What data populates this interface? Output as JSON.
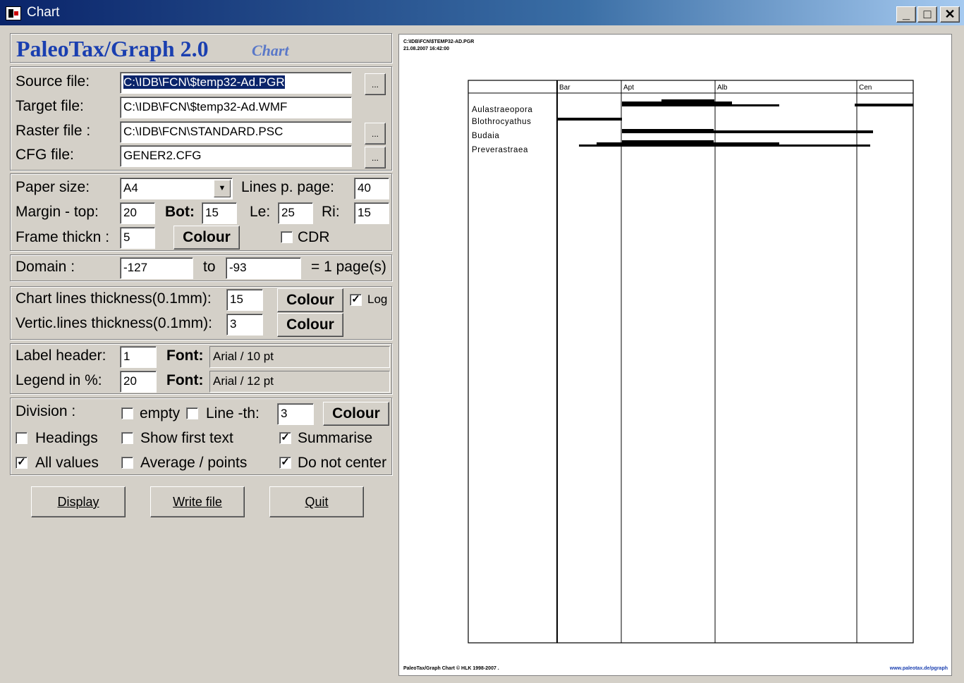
{
  "window": {
    "title": "Chart"
  },
  "app": {
    "name": "PaleoTax/Graph 2.0",
    "subtitle": "Chart"
  },
  "files": {
    "source_label": "Source file:",
    "source_value": "C:\\IDB\\FCN\\$temp32-Ad.PGR",
    "target_label": "Target file:",
    "target_value": "C:\\IDB\\FCN\\$temp32-Ad.WMF",
    "raster_label": "Raster file :",
    "raster_value": "C:\\IDB\\FCN\\STANDARD.PSC",
    "cfg_label": "CFG file:",
    "cfg_value": "GENER2.CFG",
    "browse": "..."
  },
  "page": {
    "paper_label": "Paper size:",
    "paper_value": "A4",
    "lines_label": "Lines p. page:",
    "lines_value": "40",
    "margin_top_label": "Margin - top:",
    "margin_top": "20",
    "bot_label": "Bot:",
    "bot": "15",
    "le_label": "Le:",
    "le": "25",
    "ri_label": "Ri:",
    "ri": "15",
    "frame_label": "Frame thickn :",
    "frame": "5",
    "colour": "Colour",
    "cdr_label": "CDR"
  },
  "domain": {
    "label": "Domain :",
    "from": "-127",
    "to_label": "to",
    "to": "-93",
    "pages": "= 1 page(s)"
  },
  "lines": {
    "chart_label": "Chart lines  thickness(0.1mm):",
    "chart_value": "15",
    "vert_label": "Vertic.lines thickness(0.1mm):",
    "vert_value": "3",
    "colour": "Colour",
    "log_label": "Log"
  },
  "labels": {
    "header_label": "Label header:",
    "header_value": "1",
    "legend_label": "Legend in %:",
    "legend_value": "20",
    "font_label": "Font:",
    "font1": "Arial / 10 pt",
    "font2": "Arial / 12 pt"
  },
  "division": {
    "label": "Division :",
    "empty": "empty",
    "line_th": "Line -th:",
    "line_th_value": "3",
    "colour": "Colour",
    "headings": "Headings",
    "show_first": "Show first text",
    "summarise": "Summarise",
    "all_values": "All values",
    "average": "Average / points",
    "do_not_center": "Do not center",
    "checked": {
      "empty": false,
      "line": false,
      "headings": false,
      "show_first": false,
      "summarise": true,
      "all_values": true,
      "average": false,
      "do_not_center": true
    }
  },
  "actions": {
    "display": "Display",
    "write": "Write file",
    "quit": "Quit"
  },
  "chart_page": {
    "header_path": "C:\\IDB\\FCN\\$TEMP32-AD.PGR",
    "header_date": "21.08.2007 16:42:00",
    "footer_left": "PaleoTax/Graph Chart © HLK 1998-2007 .",
    "footer_right": "www.paleotax.de/pgraph"
  },
  "chart_data": {
    "type": "range",
    "categories": [
      "Bar",
      "Apt",
      "Alb",
      "Cen"
    ],
    "taxa": [
      "Aulastraeopora",
      "Blothrocyathus",
      "Budaia",
      "Preverastraea"
    ]
  }
}
